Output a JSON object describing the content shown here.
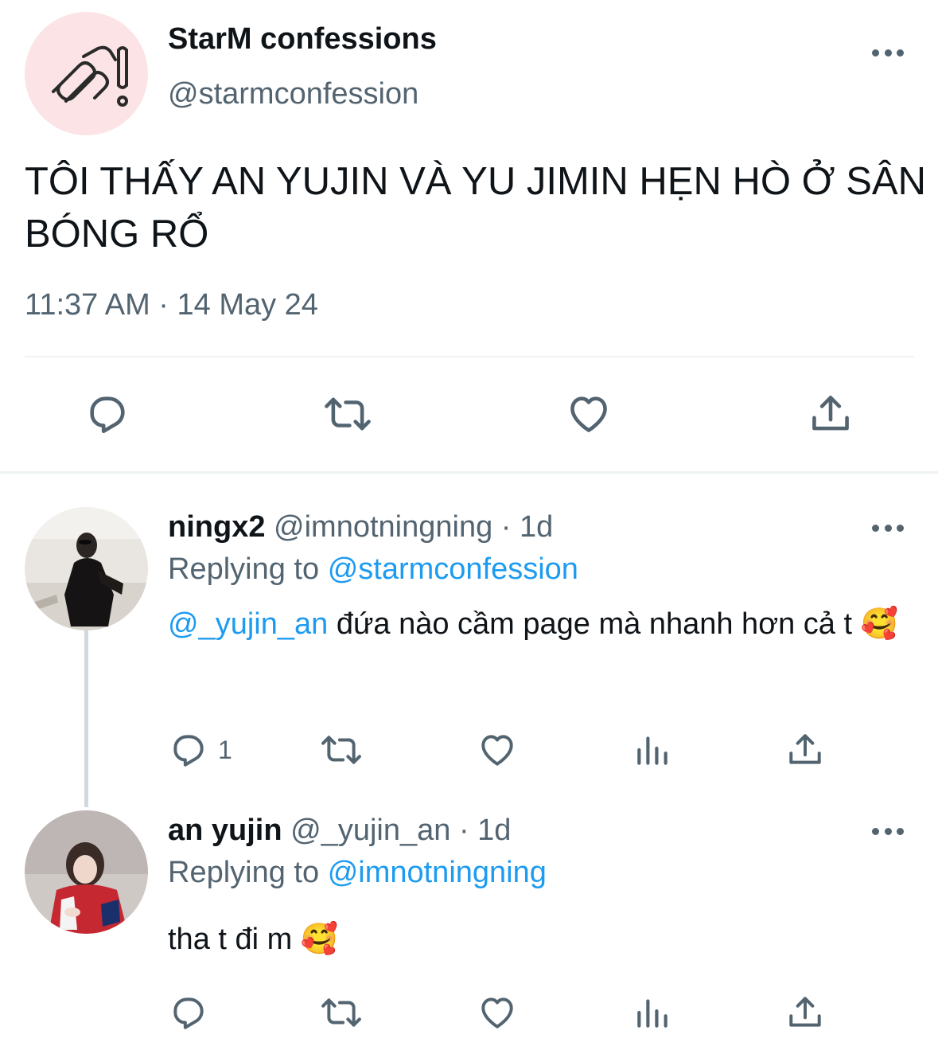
{
  "main_tweet": {
    "name": "StarM confessions",
    "handle": "@starmconfession",
    "text": "TÔI THẤY AN YUJIN VÀ YU JIMIN HẸN HÒ Ở SÂN BÓNG RỔ",
    "timestamp": "11:37 AM · 14 May 24",
    "avatar_bg": "#fbe3e6",
    "avatar_icon": "starm-logo"
  },
  "replies": [
    {
      "name": "ningx2",
      "meta": "@imnotningning · 1d",
      "replying_prefix": "Replying to",
      "replying_to": "@starmconfession",
      "mention": "@_yujin_an",
      "text": "đứa nào cầm page mà nhanh hơn cả t 🥰",
      "reply_count": "1"
    },
    {
      "name": "an yujin",
      "meta": "@_yujin_an · 1d",
      "replying_prefix": "Replying to",
      "replying_to": "@imnotningning",
      "text": "tha t đi m 🥰",
      "reply_count": ""
    }
  ],
  "colors": {
    "text": "#0f1419",
    "secondary": "#536471",
    "link": "#1d9bf0",
    "divider": "#eff3f4"
  }
}
